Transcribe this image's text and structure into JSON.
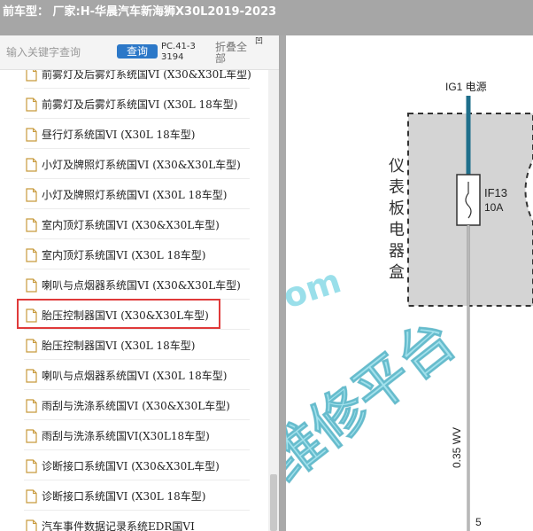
{
  "window": {
    "title": "前车型： 厂家:H-华晨汽车新海狮X30L2019-2023"
  },
  "toolbar": {
    "search_placeholder": "输入关键字查询",
    "query_label": "查询",
    "part_number": "PC.41-33194",
    "collapse_label": "折叠全部",
    "corner_glyph": "凹"
  },
  "tree": {
    "items": [
      {
        "label": "前雾灯及后雾灯系统国VI (X30&X30L车型)"
      },
      {
        "label": "前雾灯及后雾灯系统国VI (X30L 18车型)"
      },
      {
        "label": "昼行灯系统国VI (X30L 18车型)"
      },
      {
        "label": "小灯及牌照灯系统国VI (X30&X30L车型)"
      },
      {
        "label": "小灯及牌照灯系统国VI (X30L 18车型)"
      },
      {
        "label": "室内顶灯系统国VI (X30&X30L车型)"
      },
      {
        "label": "室内顶灯系统国VI (X30L 18车型)"
      },
      {
        "label": "喇叭与点烟器系统国VI (X30&X30L车型)"
      },
      {
        "label": "胎压控制器国VI (X30&X30L车型)"
      },
      {
        "label": "胎压控制器国VI (X30L 18车型)"
      },
      {
        "label": "喇叭与点烟器系统国VI (X30L 18车型)"
      },
      {
        "label": "雨刮与洗涤系统国VI (X30&X30L车型)"
      },
      {
        "label": "雨刮与洗涤系统国VI(X30L18车型)"
      },
      {
        "label": "诊断接口系统国VI (X30&X30L车型)"
      },
      {
        "label": "诊断接口系统国VI (X30L 18车型)"
      },
      {
        "label": "汽车事件数据记录系统EDR国VI"
      }
    ],
    "selected_index": 8
  },
  "diagram": {
    "power_label": "IG1 电源",
    "module_label_chars": [
      "仪",
      "表",
      "板",
      "电",
      "器",
      "盒"
    ],
    "fuse_id": "IF13",
    "fuse_rating": "10A",
    "wire_label": "0.35 WV",
    "pin_number": "5",
    "watermark_main": "维修平台",
    "watermark_domain": "om",
    "colors": {
      "wire_top": "#1f6f8b",
      "wire": "#8a8a8a",
      "box_fill": "#d4d4d4",
      "watermark": "#56c9dc"
    }
  }
}
